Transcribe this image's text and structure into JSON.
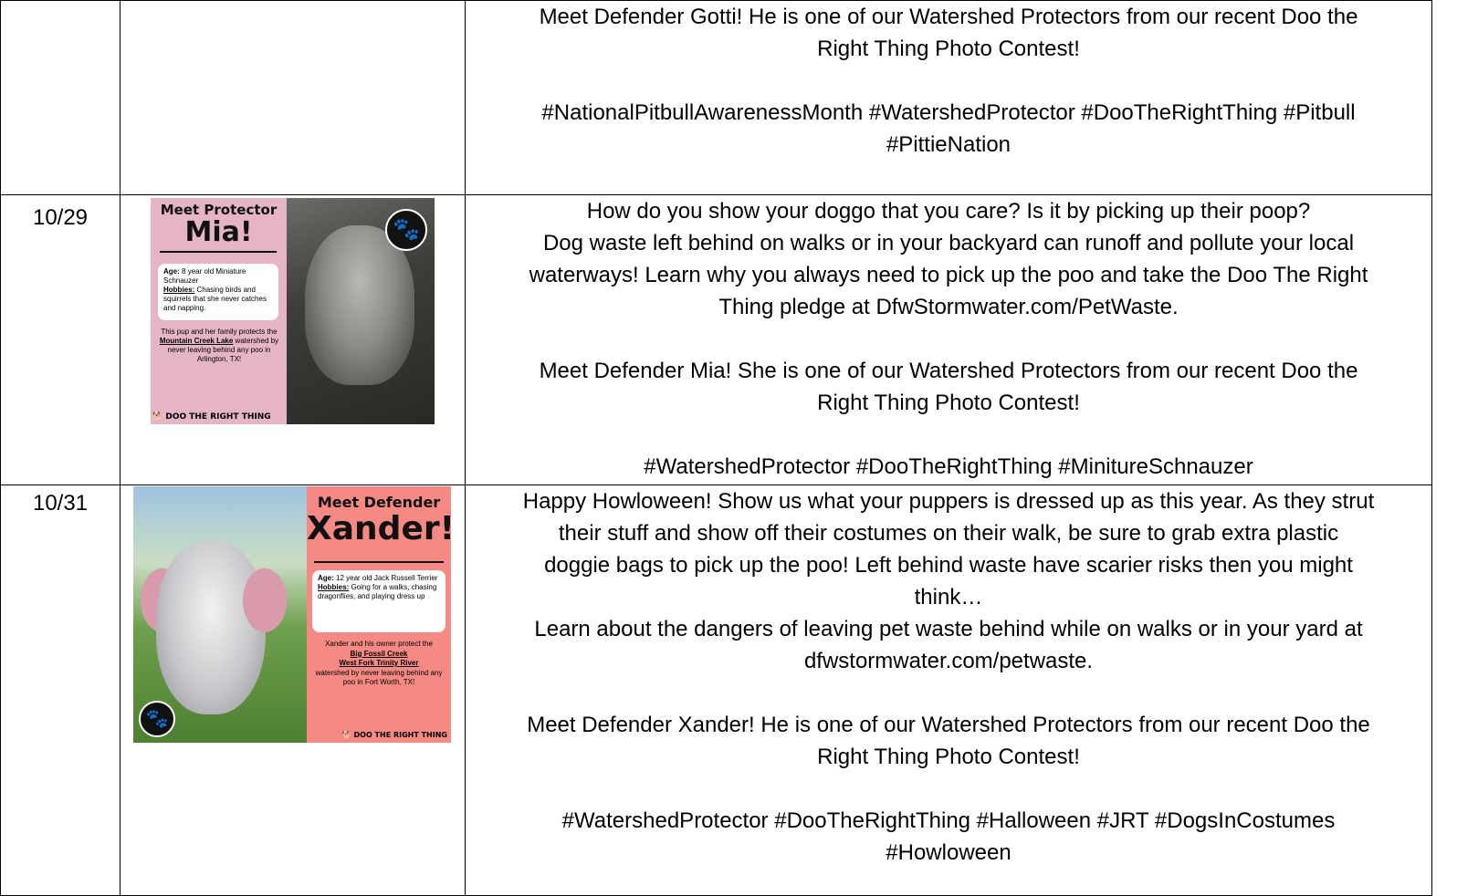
{
  "rows": [
    {
      "date": "",
      "paragraphs": [
        [
          "Meet Defender Gotti! He is one of our Watershed Protectors from our recent Doo the",
          "Right Thing Photo Contest!"
        ],
        [
          "#NationalPitbullAwarenessMonth #WatershedProtector #DooTheRightThing #Pitbull",
          "#PittieNation"
        ]
      ]
    },
    {
      "date": "10/29",
      "paragraphs": [
        [
          "How do you show your doggo that you care? Is it by picking up their poop?",
          "Dog waste left behind on walks or in your backyard can runoff and pollute your local",
          "waterways! Learn why you always need to pick up the poo and take the Doo The Right",
          "Thing pledge at DfwStormwater.com/PetWaste."
        ],
        [
          "Meet Defender Mia! She is one of our Watershed Protectors from our recent Doo the",
          "Right Thing Photo Contest!"
        ],
        [
          "#WatershedProtector #DooTheRightThing #MinitureSchnauzer"
        ]
      ],
      "graphic": {
        "title_small": "Meet Protector",
        "title_big": "Mia!",
        "age_label": "Age:",
        "age": "8 year old Miniature Schnauzer",
        "hobbies_label": "Hobbies:",
        "hobbies": "Chasing birds and squirrels that she never catches and napping.",
        "desc_pre": "This pup and her family protects the",
        "watershed": "Mountain Creek Lake",
        "desc_post": "watershed by never leaving behind any poo in Arlington, TX!",
        "brand": "DOO THE RIGHT THING",
        "paw": "🐾"
      }
    },
    {
      "date": "10/31",
      "paragraphs": [
        [
          "Happy Howloween! Show us what your puppers is dressed up as this year. As they strut",
          "their stuff and show off their costumes on their walk, be sure to grab extra plastic",
          "doggie bags to pick up the poo! Left behind waste have scarier risks then you might",
          "think…",
          "Learn about the dangers of leaving pet waste behind while on walks or in your yard at",
          "dfwstormwater.com/petwaste."
        ],
        [
          "Meet Defender Xander! He is one of our Watershed Protectors from our recent Doo the",
          "Right Thing Photo Contest!"
        ],
        [
          "#WatershedProtector #DooTheRightThing #Halloween #JRT #DogsInCostumes",
          "#Howloween"
        ]
      ],
      "graphic": {
        "title_small": "Meet Defender",
        "title_big": "Xander!",
        "age_label": "Age:",
        "age": "12 year old Jack Russell Terrier",
        "hobbies_label": "Hobbies:",
        "hobbies": "Going for a walks, chasing dragonflies, and playing dress up",
        "desc_pre": "Xander and his owner protect the",
        "watershed1": "Big Fossil Creek",
        "watershed2": "West Fork Trinity River",
        "desc_post": "watershed by never leaving behind any poo in Fort Worth, TX!",
        "brand": "DOO THE RIGHT THING",
        "paw": "🐾"
      }
    }
  ]
}
